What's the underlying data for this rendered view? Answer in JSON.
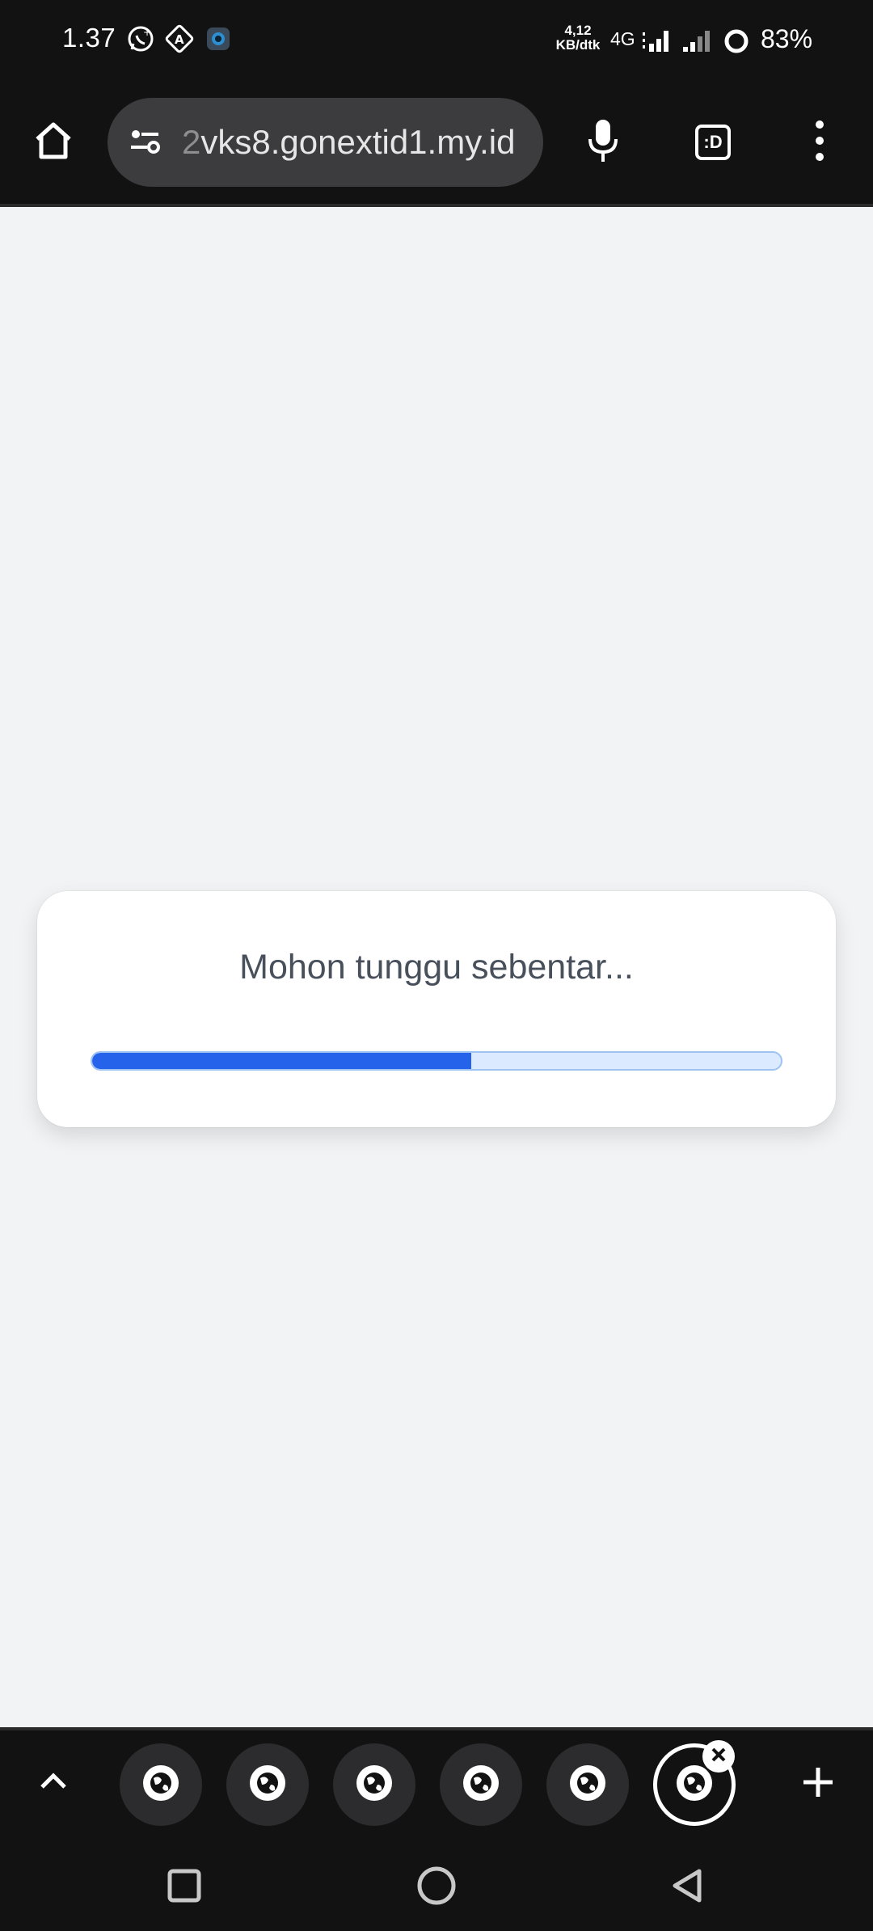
{
  "status_bar": {
    "time": "1.37",
    "notification_icons": [
      "whatsapp-icon",
      "translate-icon",
      "app-icon"
    ],
    "net_speed_value": "4,12",
    "net_speed_unit": "KB/dtk",
    "network_type": "4G",
    "battery": "83%"
  },
  "browser": {
    "url_fade": "2",
    "url_main": "vks8.gonextid1.my.id",
    "tabs_button_label": ":D",
    "icons": {
      "home": "home-icon",
      "site_settings": "tune-icon",
      "mic": "mic-icon",
      "menu": "more-vert-icon"
    }
  },
  "loading": {
    "message": "Mohon tunggu sebentar...",
    "progress": 0.55,
    "colors": {
      "fill": "#2563eb",
      "track": "#dbeafe"
    }
  },
  "tab_strip": {
    "tabs": [
      {
        "icon": "globe-icon",
        "active": false
      },
      {
        "icon": "globe-icon",
        "active": false
      },
      {
        "icon": "globe-icon",
        "active": false
      },
      {
        "icon": "globe-icon",
        "active": false
      },
      {
        "icon": "globe-icon",
        "active": false
      },
      {
        "icon": "globe-icon",
        "active": true
      }
    ]
  },
  "nav_bar": {
    "buttons": [
      "recents-icon",
      "home-circle-icon",
      "back-icon"
    ]
  }
}
